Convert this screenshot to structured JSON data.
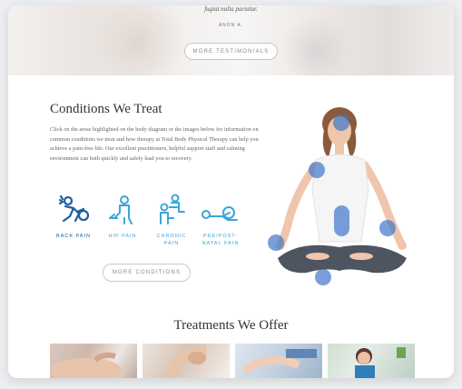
{
  "testimonial": {
    "quote": "fugiat nulla pariatur.",
    "author": "ANON A.",
    "button_label": "MORE TESTIMONIALS"
  },
  "conditions": {
    "title": "Conditions We Treat",
    "description": "Click on the areas highlighted on the body diagram or the images below for information on common conditions we treat and how therapy at Total Body Physical Therapy can help you achieve a pain-free life. Our excellent practitioners, helpful support staff and calming environment can both quickly and safely lead you to recovery.",
    "items": [
      {
        "label": "BACK PAIN",
        "icon": "back-pain-icon",
        "active": true
      },
      {
        "label": "HIP PAIN",
        "icon": "hip-pain-icon",
        "active": false
      },
      {
        "label": "CHRONIC PAIN",
        "icon": "chronic-pain-icon",
        "active": false
      },
      {
        "label": "PRE/POST-NATAL PAIN",
        "icon": "natal-pain-icon",
        "active": false
      }
    ],
    "button_label": "MORE CONDITIONS",
    "hotspots": [
      "head",
      "shoulder-left",
      "torso",
      "hand-left",
      "hand-right",
      "knee"
    ]
  },
  "treatments": {
    "title": "Treatments We Offer",
    "images": [
      "back-massage-photo",
      "knee-therapy-photo",
      "hand-therapy-photo",
      "rehab-patient-photo"
    ]
  },
  "colors": {
    "accent_blue": "#3aa5d9",
    "dark_blue": "#1c5fa3",
    "hotspot": "#3f76c9",
    "text": "#333333"
  }
}
